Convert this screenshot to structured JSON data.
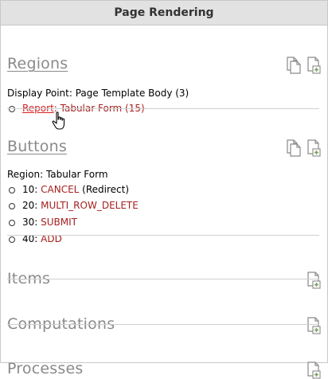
{
  "panel": {
    "title": "Page Rendering"
  },
  "regions": {
    "title": "Regions",
    "display_point": "Display Point: Page Template Body (3)",
    "items": [
      {
        "link": "Report",
        "sep": ": ",
        "name": "Tabular Form",
        "count": " (15)"
      }
    ]
  },
  "buttons": {
    "title": "Buttons",
    "region": "Region: Tabular Form",
    "items": [
      {
        "seq": "10: ",
        "name": "CANCEL",
        "extra": " (Redirect)"
      },
      {
        "seq": "20: ",
        "name": "MULTI_ROW_DELETE",
        "extra": ""
      },
      {
        "seq": "30: ",
        "name": "SUBMIT",
        "extra": ""
      },
      {
        "seq": "40: ",
        "name": "ADD",
        "extra": ""
      }
    ]
  },
  "items": {
    "title": "Items"
  },
  "computations": {
    "title": "Computations"
  },
  "processes": {
    "title": "Processes"
  },
  "icons": {
    "copy": "copy-icon",
    "add": "add-icon"
  },
  "colors": {
    "header_bg": "#e2e2e2",
    "section_title": "#8a8a8a",
    "accent_red": "#a52020",
    "link_red": "#d62020"
  }
}
